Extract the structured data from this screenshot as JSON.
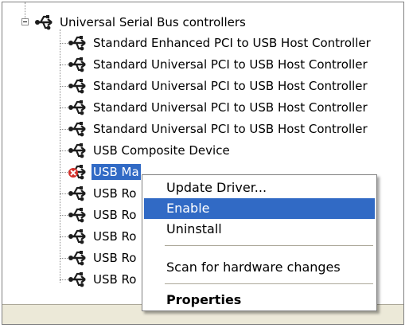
{
  "tree": {
    "category": {
      "label": "Universal Serial Bus controllers",
      "icon": "usb-controller-icon"
    },
    "devices": [
      {
        "label": "Standard Enhanced PCI to USB Host Controller",
        "icon": "usb-icon",
        "selected": false
      },
      {
        "label": "Standard Universal PCI to USB Host Controller",
        "icon": "usb-icon",
        "selected": false
      },
      {
        "label": "Standard Universal PCI to USB Host Controller",
        "icon": "usb-icon",
        "selected": false
      },
      {
        "label": "Standard Universal PCI to USB Host Controller",
        "icon": "usb-icon",
        "selected": false
      },
      {
        "label": "Standard Universal PCI to USB Host Controller",
        "icon": "usb-icon",
        "selected": false
      },
      {
        "label": "USB Composite Device",
        "icon": "usb-icon",
        "selected": false
      },
      {
        "label": "USB Ma",
        "icon": "usb-disabled-icon",
        "selected": true
      },
      {
        "label": "USB Ro",
        "icon": "usb-icon",
        "selected": false
      },
      {
        "label": "USB Ro",
        "icon": "usb-icon",
        "selected": false
      },
      {
        "label": "USB Ro",
        "icon": "usb-icon",
        "selected": false
      },
      {
        "label": "USB Ro",
        "icon": "usb-icon",
        "selected": false
      },
      {
        "label": "USB Ro",
        "icon": "usb-icon",
        "selected": false
      }
    ]
  },
  "context_menu": {
    "items": [
      {
        "label": "Update Driver...",
        "highlighted": false,
        "bold": false
      },
      {
        "label": "Enable",
        "highlighted": true,
        "bold": false
      },
      {
        "label": "Uninstall",
        "highlighted": false,
        "bold": false
      },
      {
        "label": "Scan for hardware changes",
        "highlighted": false,
        "bold": false
      },
      {
        "label": "Properties",
        "highlighted": false,
        "bold": true
      }
    ]
  },
  "colors": {
    "selection": "#316ac5",
    "disabled_mark": "#d4302a",
    "statusbar": "#ece9d8"
  }
}
